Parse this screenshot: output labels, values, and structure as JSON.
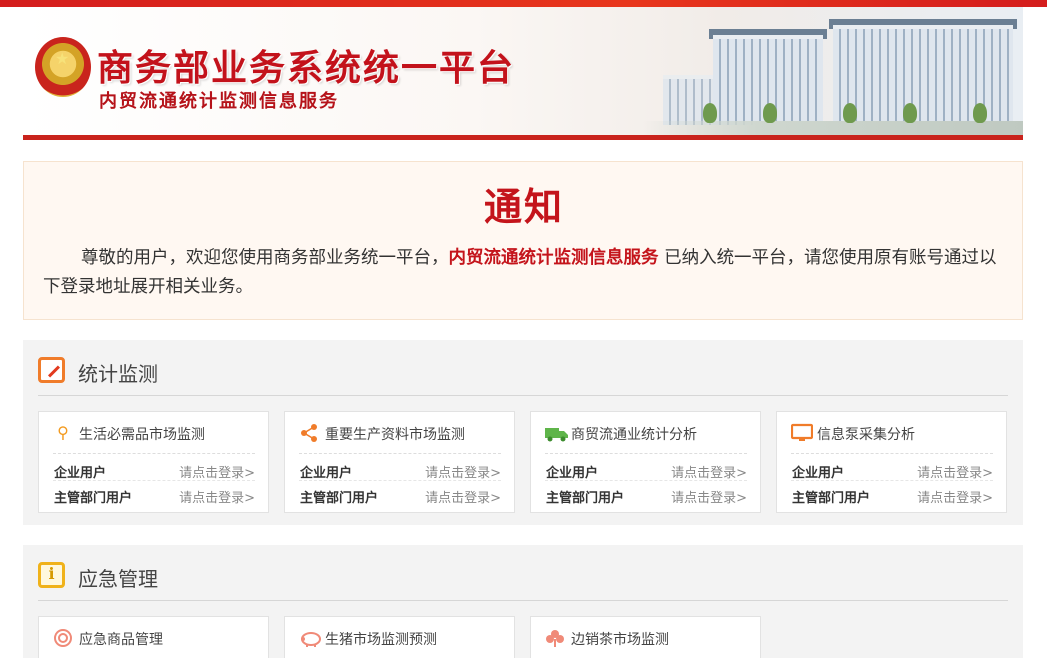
{
  "header": {
    "title": "商务部业务系统统一平台",
    "subtitle": "内贸流通统计监测信息服务"
  },
  "notice": {
    "title": "通知",
    "text_before": "尊敬的用户，欢迎您使用商务部业务统一平台，",
    "text_highlight": "内贸流通统计监测信息服务",
    "text_after": " 已纳入统一平台，请您使用原有账号通过以下登录地址展开相关业务。"
  },
  "sections": [
    {
      "title": "统计监测",
      "icon": "edit-icon",
      "cards": [
        {
          "title": "生活必需品市场监测",
          "icon": "globe-pin-icon",
          "icon_color": "#f39a1e",
          "rows": [
            {
              "label": "企业用户",
              "link": "请点击登录>"
            },
            {
              "label": "主管部门用户",
              "link": "请点击登录>"
            }
          ]
        },
        {
          "title": "重要生产资料市场监测",
          "icon": "share-icon",
          "icon_color": "#f07c2a",
          "rows": [
            {
              "label": "企业用户",
              "link": "请点击登录>"
            },
            {
              "label": "主管部门用户",
              "link": "请点击登录>"
            }
          ]
        },
        {
          "title": "商贸流通业统计分析",
          "icon": "truck-icon",
          "icon_color": "#5fb54a",
          "rows": [
            {
              "label": "企业用户",
              "link": "请点击登录>"
            },
            {
              "label": "主管部门用户",
              "link": "请点击登录>"
            }
          ]
        },
        {
          "title": "信息泵采集分析",
          "icon": "monitor-icon",
          "icon_color": "#f07c2a",
          "rows": [
            {
              "label": "企业用户",
              "link": "请点击登录>"
            },
            {
              "label": "主管部门用户",
              "link": "请点击登录>"
            }
          ]
        }
      ]
    },
    {
      "title": "应急管理",
      "icon": "info-icon",
      "cards": [
        {
          "title": "应急商品管理",
          "icon": "target-icon",
          "icon_color": "#f08a78"
        },
        {
          "title": "生猪市场监测预测",
          "icon": "pig-icon",
          "icon_color": "#f08a78"
        },
        {
          "title": "边销茶市场监测",
          "icon": "leaf-icon",
          "icon_color": "#f08a78"
        }
      ]
    }
  ],
  "colors": {
    "brand_red": "#c4141b",
    "accent_orange": "#f07c2a",
    "section_bg": "#f3f3f3",
    "notice_bg": "#fff8f2"
  }
}
